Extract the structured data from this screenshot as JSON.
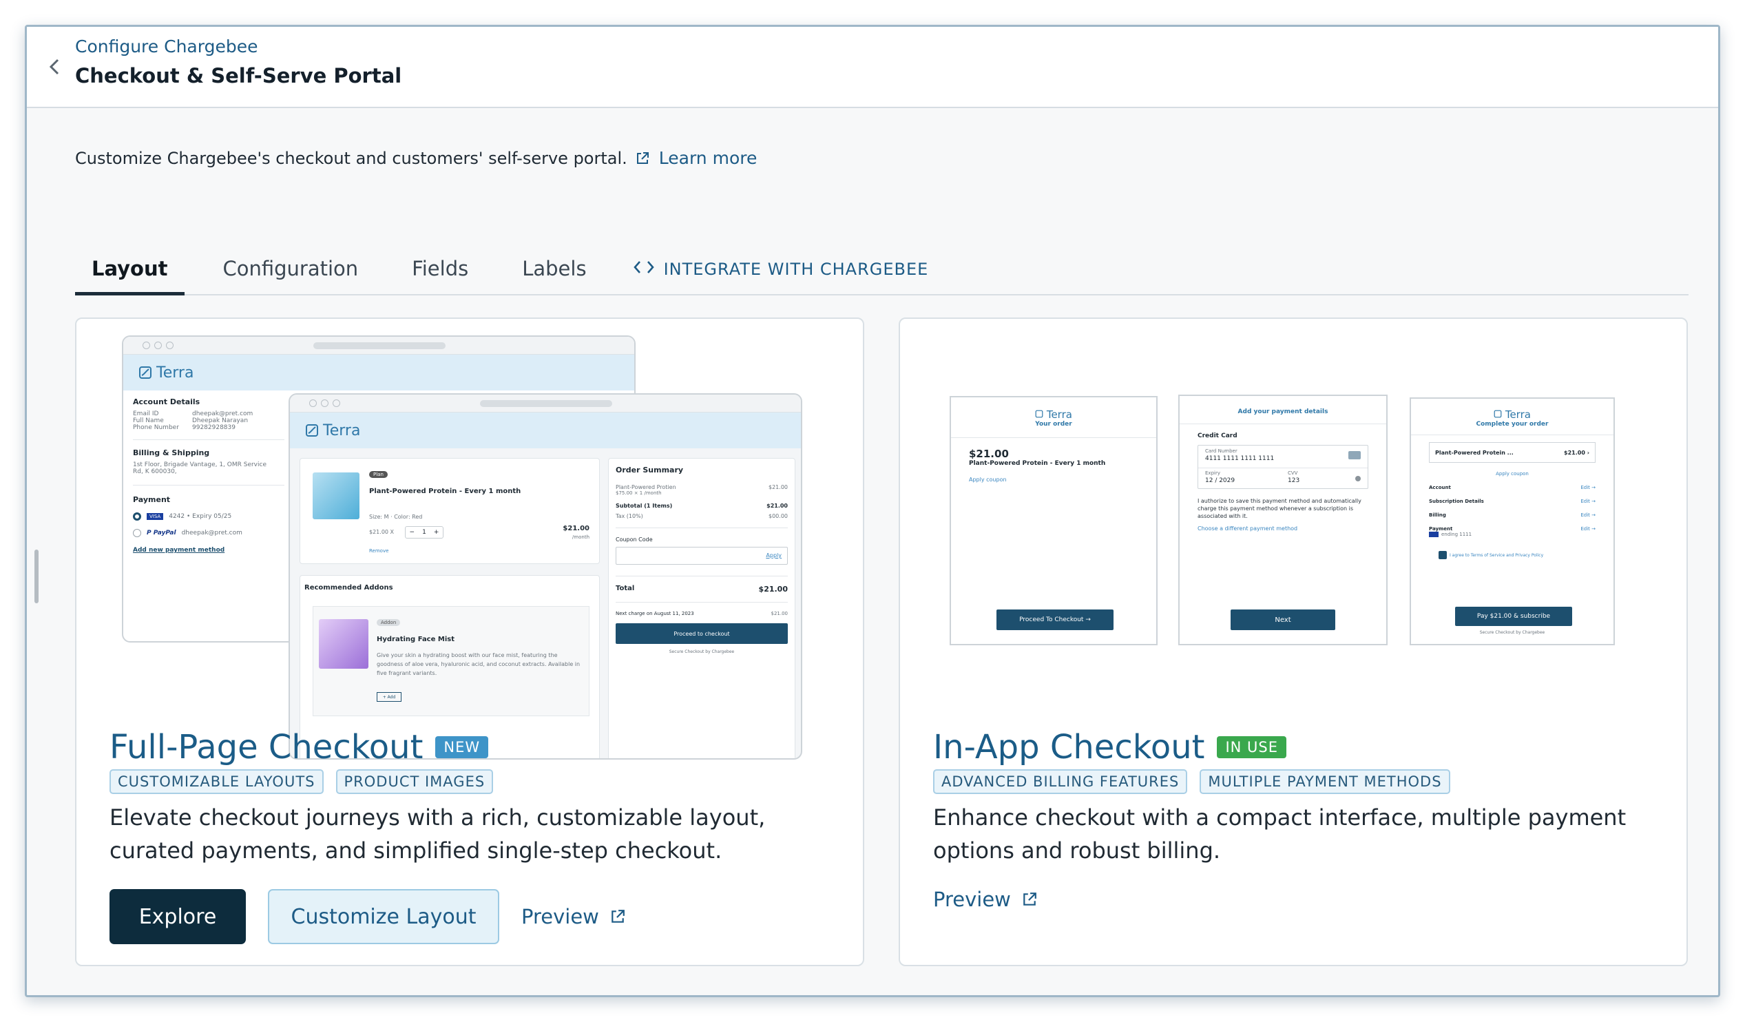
{
  "header": {
    "breadcrumb": "Configure Chargebee",
    "title": "Checkout & Self-Serve Portal"
  },
  "intro": {
    "text": "Customize Chargebee's checkout and customers' self-serve portal.",
    "learn_more": "Learn more"
  },
  "tabs": [
    {
      "label": "Layout",
      "active": true
    },
    {
      "label": "Configuration",
      "active": false
    },
    {
      "label": "Fields",
      "active": false
    },
    {
      "label": "Labels",
      "active": false
    },
    {
      "label": "INTEGRATE WITH CHARGEBEE",
      "active": false
    }
  ],
  "cards": {
    "full_page": {
      "title": "Full-Page Checkout",
      "badge": "NEW",
      "tags": [
        "CUSTOMIZABLE LAYOUTS",
        "PRODUCT IMAGES"
      ],
      "description": "Elevate checkout journeys with a rich, customizable layout, curated payments, and simplified single-step checkout.",
      "explore": "Explore",
      "customize": "Customize Layout",
      "preview": "Preview"
    },
    "in_app": {
      "title": "In-App Checkout",
      "badge": "IN USE",
      "tags": [
        "ADVANCED BILLING FEATURES",
        "MULTIPLE PAYMENT METHODS"
      ],
      "description": "Enhance checkout with a compact interface, multiple payment options and robust billing.",
      "preview": "Preview"
    }
  },
  "mock_full": {
    "brand": "Terra",
    "account_title": "Account Details",
    "email_label": "Email ID",
    "email": "dheepak@pret.com",
    "name_label": "Full Name",
    "name": "Dheepak Narayan",
    "phone_label": "Phone Number",
    "phone": "99282928839",
    "billing_title": "Billing & Shipping",
    "billing_addr": "1st Floor, Brigade Vantage, 1, OMR Service Rd, K 600030,",
    "payment_title": "Payment",
    "visa": "4242 • Expiry 05/25",
    "paypal": "dheepak@pret.com",
    "add_payment": "Add new payment method",
    "plan_badge": "Plan",
    "product": "Plant-Powered Protein - Every 1 month",
    "variant": "Size: M · Color: Red",
    "unit_price": "$21.00 X",
    "qty": "1",
    "line_total": "$21.00",
    "per": "/month",
    "remove": "Remove",
    "addons_title": "Recommended Addons",
    "addon_badge": "Addon",
    "addon_name": "Hydrating Face Mist",
    "addon_desc": "Give your skin a hydrating boost with our face mist, featuring the goodness of aloe vera, hyaluronic acid, and coconut extracts. Available in five fragrant variants.",
    "add_btn": "+ Add",
    "summary_title": "Order Summary",
    "sum_item": "Plant-Powered Protien",
    "sum_item_price": "$21.00",
    "sum_item_sub": "$75.00 × 1 /month",
    "subtotal_label": "Subtotal (1 Items)",
    "subtotal": "$21.00",
    "tax_label": "Tax (10%)",
    "tax": "$00.00",
    "coupon_label": "Coupon Code",
    "apply": "Apply",
    "total_label": "Total",
    "total": "$21.00",
    "next_charge": "Next charge on August 11, 2023",
    "next_charge_amt": "$21.00",
    "proceed": "Proceed to checkout",
    "secure": "Secure Checkout by Chargebee"
  },
  "mock_inapp": {
    "brand": "Terra",
    "s1_sub": "Your order",
    "s1_price": "$21.00",
    "s1_product": "Plant-Powered Protein - Every 1 month",
    "s1_coupon": "Apply coupon",
    "s1_btn": "Proceed To Checkout →",
    "s2_title": "Add your payment details",
    "s2_cc": "Credit Card",
    "s2_card_label": "Card Number",
    "s2_card": "4111 1111 1111 1111",
    "s2_exp_label": "Expiry",
    "s2_exp": "12 / 2029",
    "s2_cvv_label": "CVV",
    "s2_cvv": "123",
    "s2_auth": "I authorize to save this payment method and automatically charge this payment method whenever a subscription is associated with it.",
    "s2_choose": "Choose a different payment method",
    "s2_btn": "Next",
    "s3_sub": "Complete your order",
    "s3_product": "Plant-Powered Protein ...",
    "s3_price": "$21.00 ›",
    "s3_coupon": "Apply coupon",
    "s3_rows": [
      "Account",
      "Subscription Details",
      "Billing",
      "Payment"
    ],
    "s3_edit": "Edit →",
    "s3_payment_detail": "ending 1111",
    "s3_terms": "I agree to Terms of Service and Privacy Policy",
    "s3_btn": "Pay $21.00 & subscribe",
    "s3_secure": "Secure Checkout by Chargebee"
  }
}
